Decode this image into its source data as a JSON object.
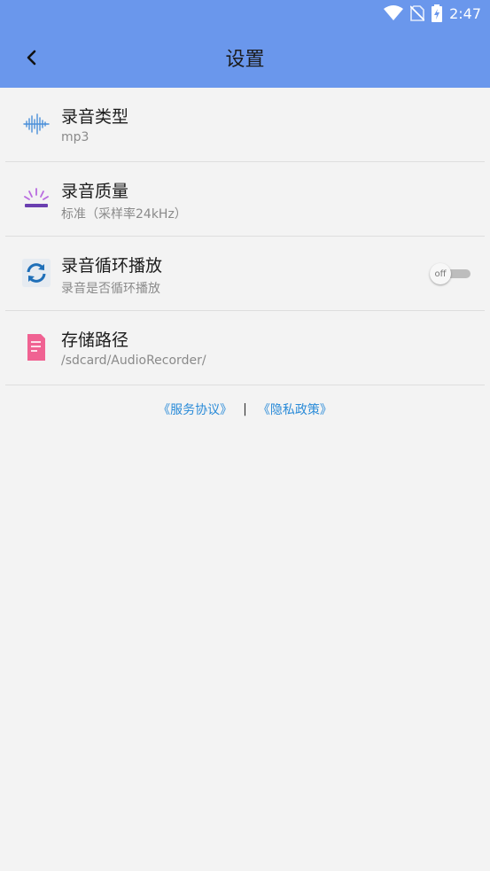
{
  "status": {
    "time": "2:47",
    "icons": [
      "wifi-icon",
      "no-sim-icon",
      "battery-charging-icon"
    ]
  },
  "toolbar": {
    "title": "设置",
    "back_icon": "chevron-left-icon"
  },
  "settings": [
    {
      "title": "录音类型",
      "subtitle": "mp3",
      "icon": "waveform-icon"
    },
    {
      "title": "录音质量",
      "subtitle": "标准（采样率24kHz）",
      "icon": "quality-glow-icon"
    },
    {
      "title": "录音循环播放",
      "subtitle": "录音是否循环播放",
      "icon": "loop-icon",
      "toggle": {
        "label": "off",
        "on": false
      }
    },
    {
      "title": "存储路径",
      "subtitle": "/sdcard/AudioRecorder/",
      "icon": "file-icon"
    }
  ],
  "links": {
    "terms": "《服务协议》",
    "separator": "|",
    "privacy": "《隐私政策》"
  },
  "colors": {
    "header": "#6a97ec",
    "link": "#2a8bd8",
    "background": "#f3f3f3"
  }
}
